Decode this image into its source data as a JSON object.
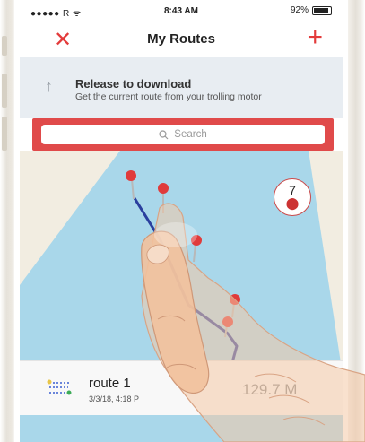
{
  "status_bar": {
    "carrier": "●●●●● R ᯤ",
    "time": "8:43 AM",
    "battery": "92%"
  },
  "nav": {
    "title": "My Routes",
    "close_icon": "close-icon",
    "add_icon": "add-icon"
  },
  "pull_to_refresh": {
    "title": "Release to download",
    "subtitle": "Get the current route from your trolling motor"
  },
  "search": {
    "placeholder": "Search",
    "icon": "search-icon"
  },
  "map": {
    "cluster_count": "7",
    "water_color": "#a9d7ea",
    "land_color": "#f2ede1",
    "route_color": "#2a3f9e"
  },
  "route": {
    "name": "route 1",
    "date": "3/3/18, 4:18 P",
    "distance": "129.7 M"
  },
  "colors": {
    "accent": "#e33b3b",
    "search_frame": "#e04a4a",
    "pin": "#e03b3b"
  }
}
